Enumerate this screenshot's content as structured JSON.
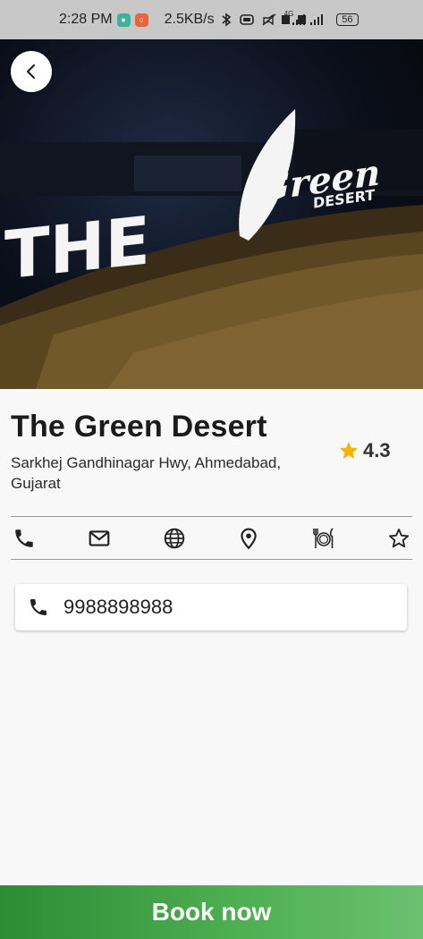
{
  "status_bar": {
    "time": "2:28 PM",
    "speed": "2.5KB/s",
    "network": "4G",
    "battery": "56"
  },
  "hero": {
    "sign_text_1": "THE",
    "sign_text_2": "Green",
    "sign_text_3": "DESERT"
  },
  "place": {
    "name": "The Green Desert",
    "address": "Sarkhej Gandhinagar Hwy, Ahmedabad, Gujarat",
    "rating": "4.3"
  },
  "actions": [
    "call-icon",
    "mail-icon",
    "globe-icon",
    "location-pin-icon",
    "restaurant-menu-icon",
    "star-outline-icon"
  ],
  "contact": {
    "phone": "9988898988"
  },
  "cta": {
    "book_label": "Book now"
  },
  "colors": {
    "accent_green": "#4caf50",
    "star": "#f5b400"
  }
}
